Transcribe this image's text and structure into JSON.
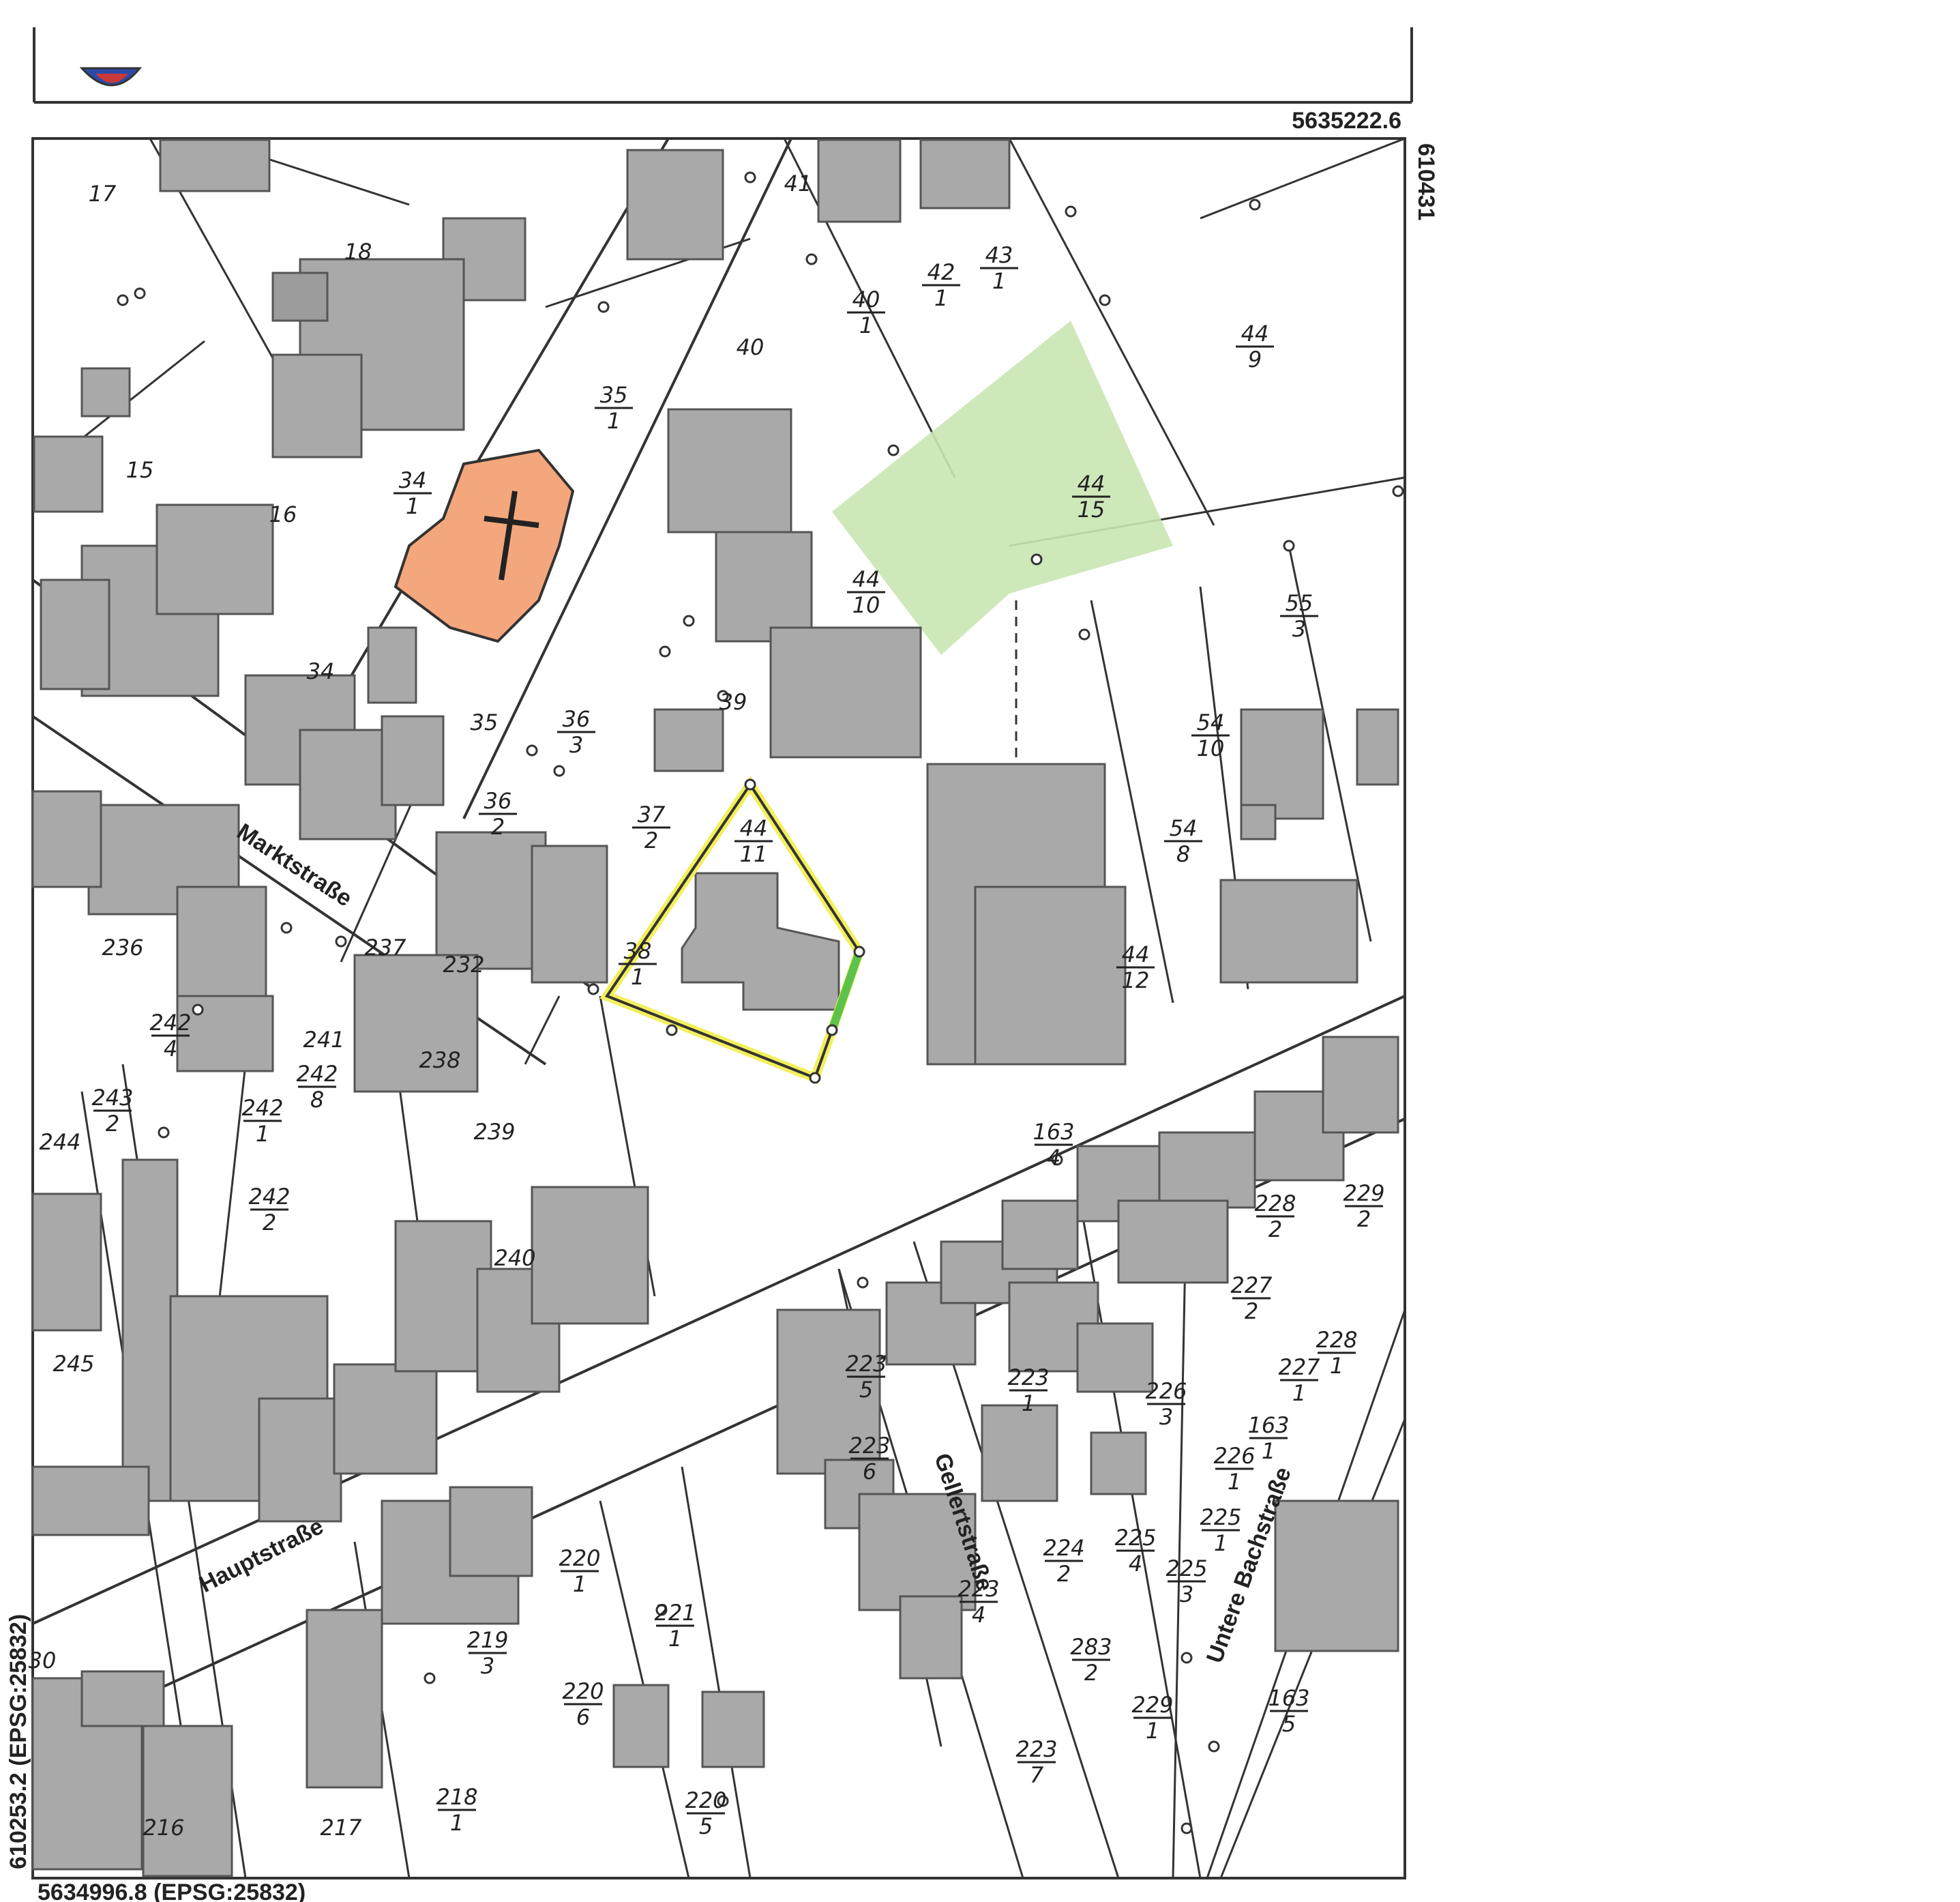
{
  "header": {
    "coord_top_right": "5635222.6",
    "coord_right_vertical": "610431",
    "coord_bottom_left": "5634996.8 (EPSG:25832)",
    "coord_left_vertical": "610253.2 (EPSG:25832)"
  },
  "colors": {
    "church": "#f4a77c",
    "green_parcel": "#c9e6b3",
    "selected_outline": "#f2ef5c",
    "selected_edge": "#5cc24a",
    "building": "#a9a9a9"
  },
  "streets": {
    "marktstrasse": "Marktstraße",
    "hauptstrasse": "Hauptstraße",
    "gellertstrasse": "Gellertstraße",
    "untere_bachstrasse": "Untere Bachstraße"
  },
  "parcels": [
    {
      "num": "17"
    },
    {
      "num": "18"
    },
    {
      "num": "15"
    },
    {
      "num": "16"
    },
    {
      "num": "34",
      "sub": "1"
    },
    {
      "num": "34"
    },
    {
      "num": "35",
      "sub": "1"
    },
    {
      "num": "35"
    },
    {
      "num": "36",
      "sub": "3"
    },
    {
      "num": "36",
      "sub": "2"
    },
    {
      "num": "37",
      "sub": "2"
    },
    {
      "num": "38",
      "sub": "1"
    },
    {
      "num": "44",
      "sub": "11"
    },
    {
      "num": "44",
      "sub": "10"
    },
    {
      "num": "44",
      "sub": "15"
    },
    {
      "num": "44",
      "sub": "9"
    },
    {
      "num": "44",
      "sub": "12"
    },
    {
      "num": "41"
    },
    {
      "num": "40",
      "sub": "1"
    },
    {
      "num": "40"
    },
    {
      "num": "42",
      "sub": "1"
    },
    {
      "num": "43",
      "sub": "1"
    },
    {
      "num": "55",
      "sub": "3"
    },
    {
      "num": "54",
      "sub": "10"
    },
    {
      "num": "54",
      "sub": "8"
    },
    {
      "num": "39"
    },
    {
      "num": "236"
    },
    {
      "num": "237"
    },
    {
      "num": "232"
    },
    {
      "num": "242",
      "sub": "4"
    },
    {
      "num": "241"
    },
    {
      "num": "242",
      "sub": "8"
    },
    {
      "num": "238"
    },
    {
      "num": "243",
      "sub": "2"
    },
    {
      "num": "242",
      "sub": "1"
    },
    {
      "num": "244"
    },
    {
      "num": "239"
    },
    {
      "num": "242",
      "sub": "2"
    },
    {
      "num": "240"
    },
    {
      "num": "245"
    },
    {
      "num": "163",
      "sub": "4"
    },
    {
      "num": "228",
      "sub": "2"
    },
    {
      "num": "229",
      "sub": "2"
    },
    {
      "num": "227",
      "sub": "2"
    },
    {
      "num": "228",
      "sub": "1"
    },
    {
      "num": "223",
      "sub": "5"
    },
    {
      "num": "223",
      "sub": "1"
    },
    {
      "num": "223",
      "sub": "6"
    },
    {
      "num": "226",
      "sub": "3"
    },
    {
      "num": "227",
      "sub": "1"
    },
    {
      "num": "163",
      "sub": "1"
    },
    {
      "num": "226",
      "sub": "1"
    },
    {
      "num": "225",
      "sub": "1"
    },
    {
      "num": "220",
      "sub": "1"
    },
    {
      "num": "221",
      "sub": "1"
    },
    {
      "num": "219",
      "sub": "3"
    },
    {
      "num": "224",
      "sub": "2"
    },
    {
      "num": "225",
      "sub": "4"
    },
    {
      "num": "225",
      "sub": "3"
    },
    {
      "num": "223",
      "sub": "4"
    },
    {
      "num": "283",
      "sub": "2"
    },
    {
      "num": "220",
      "sub": "6"
    },
    {
      "num": "229",
      "sub": "1"
    },
    {
      "num": "163",
      "sub": "5"
    },
    {
      "num": "223",
      "sub": "7"
    },
    {
      "num": "218",
      "sub": "1"
    },
    {
      "num": "220",
      "sub": "5"
    },
    {
      "num": "216"
    },
    {
      "num": "217"
    },
    {
      "num": "30"
    }
  ]
}
